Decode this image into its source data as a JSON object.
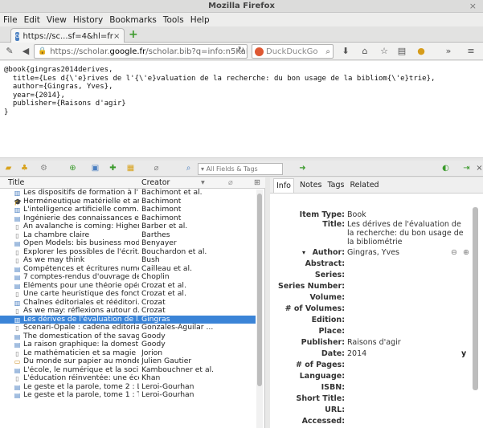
{
  "window": {
    "title": "Mozilla Firefox",
    "close_glyph": "×"
  },
  "menubar": [
    "File",
    "Edit",
    "View",
    "History",
    "Bookmarks",
    "Tools",
    "Help"
  ],
  "tab": {
    "label": "https://sc...sf=4&hl=fr",
    "close_glyph": "×",
    "favicon_text": "G"
  },
  "navbar": {
    "url_prefix": "https://scholar.",
    "url_host": "google.fr",
    "url_rest": "/scholar.bib?q=info:n5KaFyKM",
    "search_placeholder": "DuckDuckGo"
  },
  "bibtex": "@book{gingras2014derives,\n  title={Les d{\\'e}rives de l'{\\'e}valuation de la recherche: du bon usage de la bibliom{\\'e}trie},\n  author={Gingras, Yves},\n  year={2014},\n  publisher={Raisons d'agir}\n}",
  "zotero": {
    "search_placeholder": "All Fields & Tags",
    "columns": {
      "title": "Title",
      "creator": "Creator"
    },
    "items": [
      {
        "icon": "book",
        "title": "Les dispositifs de formation à l'...",
        "creator": "Bachimont et al."
      },
      {
        "icon": "thesis",
        "title": "Herméneutique matérielle et ar...",
        "creator": "Bachimont"
      },
      {
        "icon": "book",
        "title": "L'intelligence artificielle comm...",
        "creator": "Bachimont"
      },
      {
        "icon": "journal",
        "title": "Ingénierie des connaissances et...",
        "creator": "Bachimont"
      },
      {
        "icon": "document",
        "title": "An avalanche is coming: Higher...",
        "creator": "Barber et al."
      },
      {
        "icon": "document",
        "title": "La chambre claire",
        "creator": "Barthes"
      },
      {
        "icon": "journal",
        "title": "Open Models: bis business mod...",
        "creator": "Benyayer"
      },
      {
        "icon": "document",
        "title": "Explorer les possibles de l'écrit...",
        "creator": "Bouchardon et al."
      },
      {
        "icon": "document",
        "title": "As we may think",
        "creator": "Bush"
      },
      {
        "icon": "journal",
        "title": "Compétences et écritures numé...",
        "creator": "Cailleau et al."
      },
      {
        "icon": "journal",
        "title": "7 comptes-rendus d'ouvrage de...",
        "creator": "Choplin"
      },
      {
        "icon": "journal",
        "title": "Éléments pour une théorie opér...",
        "creator": "Crozat et al."
      },
      {
        "icon": "document",
        "title": "Une carte heuristique des foncti...",
        "creator": "Crozat et al."
      },
      {
        "icon": "book",
        "title": "Chaînes éditoriales et rééditori...",
        "creator": "Crozat"
      },
      {
        "icon": "document",
        "title": "As we may: réflexions autour d...",
        "creator": "Crozat"
      },
      {
        "icon": "book",
        "title": "Les dérives de l'évaluation de l...",
        "creator": "Gingras",
        "selected": true
      },
      {
        "icon": "document",
        "title": "Scenari-Opale : cadena editorial...",
        "creator": "Gonzales-Aguilar ..."
      },
      {
        "icon": "journal",
        "title": "The domestication of the savag...",
        "creator": "Goody"
      },
      {
        "icon": "journal",
        "title": "La raison graphique: la domesti...",
        "creator": "Goody"
      },
      {
        "icon": "document",
        "title": "Le mathématicien et sa magie :...",
        "creator": "Jorion"
      },
      {
        "icon": "presentation",
        "title": "Du monde sur papier au monde...",
        "creator": "Julien Gautier"
      },
      {
        "icon": "journal",
        "title": "L'école, le numérique et la soci...",
        "creator": "Kambouchner et al."
      },
      {
        "icon": "document",
        "title": "L'éducation réinventée: une éco...",
        "creator": "Khan"
      },
      {
        "icon": "journal",
        "title": "Le geste et la parole, tome 2 : L...",
        "creator": "Leroi-Gourhan"
      },
      {
        "icon": "journal",
        "title": "Le geste et la parole, tome 1 : T...",
        "creator": "Leroi-Gourhan"
      }
    ],
    "detail_tabs": [
      "Info",
      "Notes",
      "Tags",
      "Related"
    ],
    "fields": [
      {
        "label": "Item Type:",
        "value": "Book"
      },
      {
        "label": "Title:",
        "value": "Les dérives de l'évaluation de la recherche: du bon usage de la bibliométrie"
      },
      {
        "label": "Author:",
        "value": "Gingras, Yves"
      },
      {
        "label": "Abstract:",
        "value": ""
      },
      {
        "label": "Series:",
        "value": ""
      },
      {
        "label": "Series Number:",
        "value": ""
      },
      {
        "label": "Volume:",
        "value": ""
      },
      {
        "label": "# of Volumes:",
        "value": ""
      },
      {
        "label": "Edition:",
        "value": ""
      },
      {
        "label": "Place:",
        "value": ""
      },
      {
        "label": "Publisher:",
        "value": "Raisons d'agir"
      },
      {
        "label": "Date:",
        "value": "2014",
        "suffix": "y"
      },
      {
        "label": "# of Pages:",
        "value": ""
      },
      {
        "label": "Language:",
        "value": ""
      },
      {
        "label": "ISBN:",
        "value": ""
      },
      {
        "label": "Short Title:",
        "value": ""
      },
      {
        "label": "URL:",
        "value": ""
      },
      {
        "label": "Accessed:",
        "value": ""
      }
    ]
  }
}
